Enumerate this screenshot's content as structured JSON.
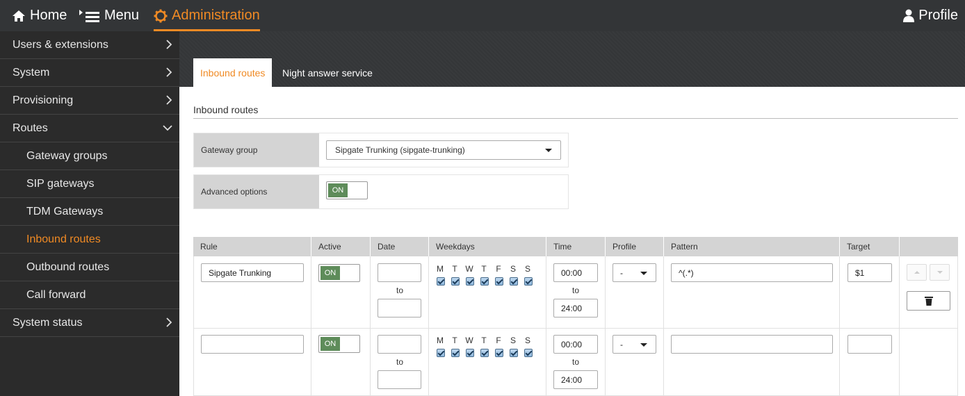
{
  "topbar": {
    "home": "Home",
    "menu": "Menu",
    "administration": "Administration",
    "profile": "Profile"
  },
  "sidebar": {
    "items": [
      {
        "label": "Users & extensions"
      },
      {
        "label": "System"
      },
      {
        "label": "Provisioning"
      },
      {
        "label": "Routes"
      },
      {
        "label": "Gateway groups"
      },
      {
        "label": "SIP gateways"
      },
      {
        "label": "TDM Gateways"
      },
      {
        "label": "Inbound routes"
      },
      {
        "label": "Outbound routes"
      },
      {
        "label": "Call forward"
      },
      {
        "label": "System status"
      }
    ]
  },
  "tabs": {
    "inbound": "Inbound routes",
    "night": "Night answer service"
  },
  "section": {
    "title": "Inbound routes",
    "gateway_group_label": "Gateway group",
    "gateway_group_value": "Sipgate Trunking (sipgate-trunking)",
    "advanced_label": "Advanced options",
    "advanced_toggle": "ON"
  },
  "table": {
    "headers": {
      "rule": "Rule",
      "active": "Active",
      "date": "Date",
      "weekdays": "Weekdays",
      "time": "Time",
      "profile": "Profile",
      "pattern": "Pattern",
      "target": "Target"
    },
    "weekdays": [
      "M",
      "T",
      "W",
      "T",
      "F",
      "S",
      "S"
    ],
    "to_label": "to",
    "rows": [
      {
        "rule": "Sipgate Trunking",
        "active": "ON",
        "date_from": "",
        "date_to": "",
        "time_from": "00:00",
        "time_to": "24:00",
        "profile": "-",
        "pattern": "^(.*)",
        "target": "$1"
      },
      {
        "rule": "",
        "active": "ON",
        "date_from": "",
        "date_to": "",
        "time_from": "00:00",
        "time_to": "24:00",
        "profile": "-",
        "pattern": "",
        "target": ""
      }
    ]
  },
  "colors": {
    "accent": "#f08a24",
    "toggle_on": "#5e8c5a",
    "topbar": "#333537",
    "sidebar": "#2b2b2b"
  }
}
